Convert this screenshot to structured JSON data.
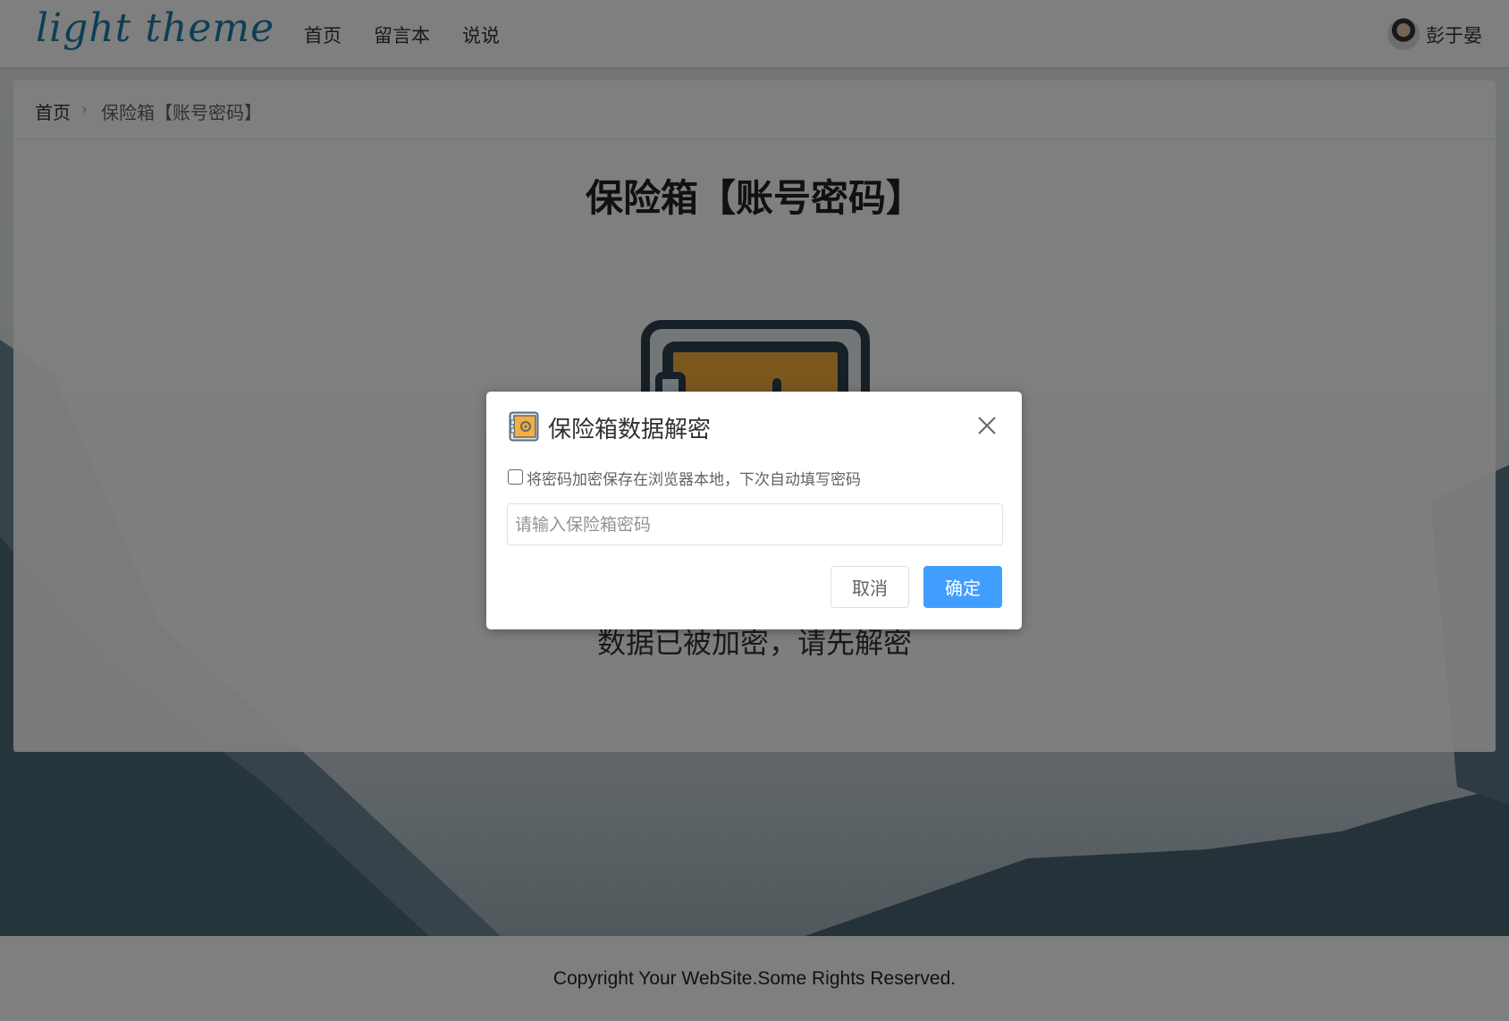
{
  "header": {
    "logo": "light theme",
    "nav": [
      "首页",
      "留言本",
      "说说"
    ],
    "user_name": "彭于晏"
  },
  "breadcrumb": {
    "home": "首页",
    "separator": ">",
    "current": "保险箱【账号密码】"
  },
  "page": {
    "title": "保险箱【账号密码】",
    "locked_message": "数据已被加密，请先解密"
  },
  "footer": {
    "copyright": "Copyright Your WebSite.Some Rights Reserved."
  },
  "dialog": {
    "title": "保险箱数据解密",
    "icon": "safe-icon",
    "remember_label": "将密码加密保存在浏览器本地，下次自动填写密码",
    "remember_checked": false,
    "password_placeholder": "请输入保险箱密码",
    "password_value": "",
    "cancel_label": "取消",
    "confirm_label": "确定"
  },
  "colors": {
    "primary": "#409eff",
    "logo": "#1b7fa8",
    "safe_door": "#f6ae3c",
    "safe_frame": "#2f3f4f"
  }
}
